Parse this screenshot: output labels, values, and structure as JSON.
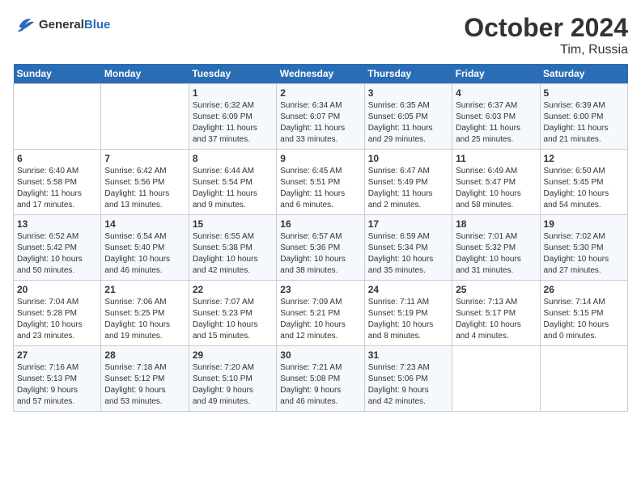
{
  "header": {
    "logo_line1": "General",
    "logo_line2": "Blue",
    "title": "October 2024",
    "subtitle": "Tim, Russia"
  },
  "weekdays": [
    "Sunday",
    "Monday",
    "Tuesday",
    "Wednesday",
    "Thursday",
    "Friday",
    "Saturday"
  ],
  "weeks": [
    [
      {
        "day": "",
        "info": ""
      },
      {
        "day": "",
        "info": ""
      },
      {
        "day": "1",
        "info": "Sunrise: 6:32 AM\nSunset: 6:09 PM\nDaylight: 11 hours\nand 37 minutes."
      },
      {
        "day": "2",
        "info": "Sunrise: 6:34 AM\nSunset: 6:07 PM\nDaylight: 11 hours\nand 33 minutes."
      },
      {
        "day": "3",
        "info": "Sunrise: 6:35 AM\nSunset: 6:05 PM\nDaylight: 11 hours\nand 29 minutes."
      },
      {
        "day": "4",
        "info": "Sunrise: 6:37 AM\nSunset: 6:03 PM\nDaylight: 11 hours\nand 25 minutes."
      },
      {
        "day": "5",
        "info": "Sunrise: 6:39 AM\nSunset: 6:00 PM\nDaylight: 11 hours\nand 21 minutes."
      }
    ],
    [
      {
        "day": "6",
        "info": "Sunrise: 6:40 AM\nSunset: 5:58 PM\nDaylight: 11 hours\nand 17 minutes."
      },
      {
        "day": "7",
        "info": "Sunrise: 6:42 AM\nSunset: 5:56 PM\nDaylight: 11 hours\nand 13 minutes."
      },
      {
        "day": "8",
        "info": "Sunrise: 6:44 AM\nSunset: 5:54 PM\nDaylight: 11 hours\nand 9 minutes."
      },
      {
        "day": "9",
        "info": "Sunrise: 6:45 AM\nSunset: 5:51 PM\nDaylight: 11 hours\nand 6 minutes."
      },
      {
        "day": "10",
        "info": "Sunrise: 6:47 AM\nSunset: 5:49 PM\nDaylight: 11 hours\nand 2 minutes."
      },
      {
        "day": "11",
        "info": "Sunrise: 6:49 AM\nSunset: 5:47 PM\nDaylight: 10 hours\nand 58 minutes."
      },
      {
        "day": "12",
        "info": "Sunrise: 6:50 AM\nSunset: 5:45 PM\nDaylight: 10 hours\nand 54 minutes."
      }
    ],
    [
      {
        "day": "13",
        "info": "Sunrise: 6:52 AM\nSunset: 5:42 PM\nDaylight: 10 hours\nand 50 minutes."
      },
      {
        "day": "14",
        "info": "Sunrise: 6:54 AM\nSunset: 5:40 PM\nDaylight: 10 hours\nand 46 minutes."
      },
      {
        "day": "15",
        "info": "Sunrise: 6:55 AM\nSunset: 5:38 PM\nDaylight: 10 hours\nand 42 minutes."
      },
      {
        "day": "16",
        "info": "Sunrise: 6:57 AM\nSunset: 5:36 PM\nDaylight: 10 hours\nand 38 minutes."
      },
      {
        "day": "17",
        "info": "Sunrise: 6:59 AM\nSunset: 5:34 PM\nDaylight: 10 hours\nand 35 minutes."
      },
      {
        "day": "18",
        "info": "Sunrise: 7:01 AM\nSunset: 5:32 PM\nDaylight: 10 hours\nand 31 minutes."
      },
      {
        "day": "19",
        "info": "Sunrise: 7:02 AM\nSunset: 5:30 PM\nDaylight: 10 hours\nand 27 minutes."
      }
    ],
    [
      {
        "day": "20",
        "info": "Sunrise: 7:04 AM\nSunset: 5:28 PM\nDaylight: 10 hours\nand 23 minutes."
      },
      {
        "day": "21",
        "info": "Sunrise: 7:06 AM\nSunset: 5:25 PM\nDaylight: 10 hours\nand 19 minutes."
      },
      {
        "day": "22",
        "info": "Sunrise: 7:07 AM\nSunset: 5:23 PM\nDaylight: 10 hours\nand 15 minutes."
      },
      {
        "day": "23",
        "info": "Sunrise: 7:09 AM\nSunset: 5:21 PM\nDaylight: 10 hours\nand 12 minutes."
      },
      {
        "day": "24",
        "info": "Sunrise: 7:11 AM\nSunset: 5:19 PM\nDaylight: 10 hours\nand 8 minutes."
      },
      {
        "day": "25",
        "info": "Sunrise: 7:13 AM\nSunset: 5:17 PM\nDaylight: 10 hours\nand 4 minutes."
      },
      {
        "day": "26",
        "info": "Sunrise: 7:14 AM\nSunset: 5:15 PM\nDaylight: 10 hours\nand 0 minutes."
      }
    ],
    [
      {
        "day": "27",
        "info": "Sunrise: 7:16 AM\nSunset: 5:13 PM\nDaylight: 9 hours\nand 57 minutes."
      },
      {
        "day": "28",
        "info": "Sunrise: 7:18 AM\nSunset: 5:12 PM\nDaylight: 9 hours\nand 53 minutes."
      },
      {
        "day": "29",
        "info": "Sunrise: 7:20 AM\nSunset: 5:10 PM\nDaylight: 9 hours\nand 49 minutes."
      },
      {
        "day": "30",
        "info": "Sunrise: 7:21 AM\nSunset: 5:08 PM\nDaylight: 9 hours\nand 46 minutes."
      },
      {
        "day": "31",
        "info": "Sunrise: 7:23 AM\nSunset: 5:06 PM\nDaylight: 9 hours\nand 42 minutes."
      },
      {
        "day": "",
        "info": ""
      },
      {
        "day": "",
        "info": ""
      }
    ]
  ]
}
